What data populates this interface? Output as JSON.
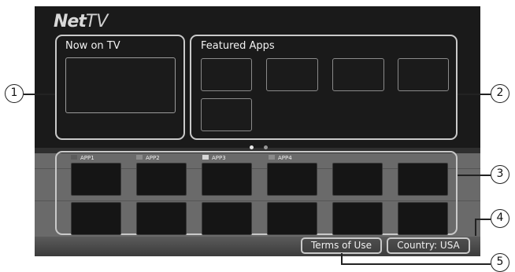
{
  "brand": {
    "part1": "Net",
    "part2": "TV"
  },
  "now_on_tv": {
    "title": "Now on TV"
  },
  "featured_apps": {
    "title": "Featured Apps"
  },
  "app_labels": [
    {
      "label": "APP1",
      "color": "#5c5c5c"
    },
    {
      "label": "APP2",
      "color": "#8a8a8a"
    },
    {
      "label": "APP3",
      "color": "#d6d6d6"
    },
    {
      "label": "APP4",
      "color": "#8a8a8a"
    }
  ],
  "footer": {
    "terms_label": "Terms of Use",
    "country_label": "Country: USA"
  },
  "callouts": [
    "1",
    "2",
    "3",
    "4",
    "5"
  ]
}
